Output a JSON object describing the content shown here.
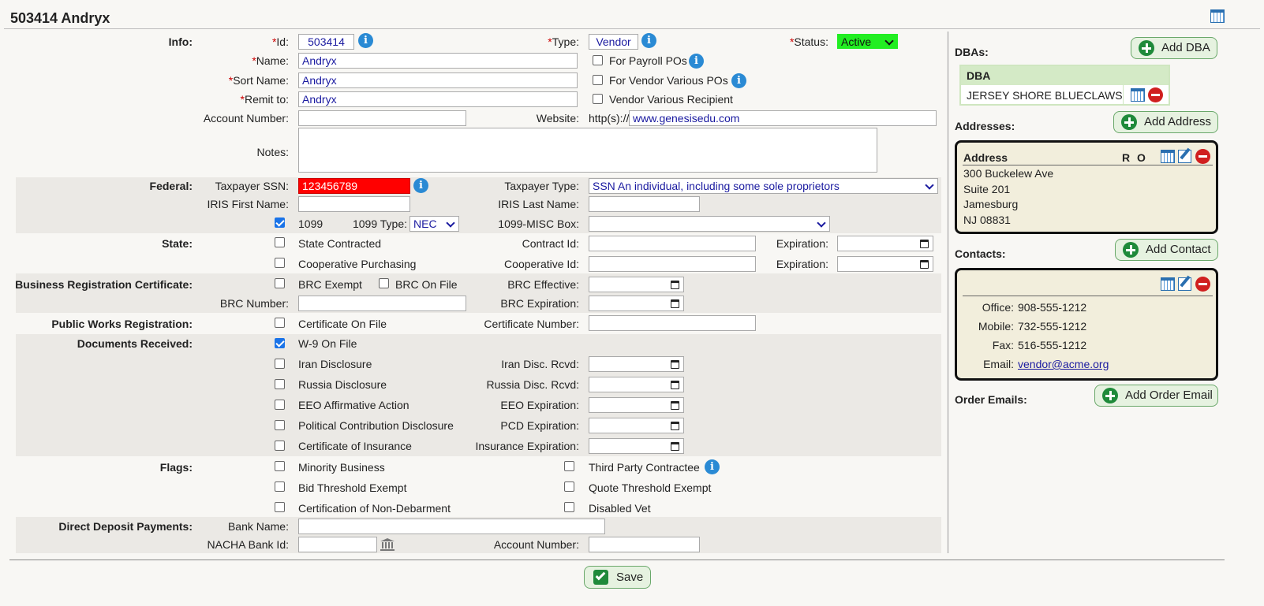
{
  "header": {
    "title": "503414 Andryx"
  },
  "info": {
    "section": "Info:",
    "id_label": "Id:",
    "id_value": "503414",
    "type_label": "Type:",
    "type_value": "Vendor",
    "status_label": "Status:",
    "status_value": "Active",
    "name_label": "Name:",
    "name_value": "Andryx",
    "sortname_label": "Sort Name:",
    "sortname_value": "Andryx",
    "remit_label": "Remit to:",
    "remit_value": "Andryx",
    "account_label": "Account Number:",
    "account_value": "",
    "website_label": "Website:",
    "website_prefix": "http(s)://",
    "website_value": "www.genesisedu.com",
    "notes_label": "Notes:",
    "notes_value": "",
    "for_payroll": "For Payroll POs",
    "for_vendor_various": "For Vendor Various POs",
    "vendor_various_recipient": "Vendor Various Recipient",
    "star": "*"
  },
  "federal": {
    "section": "Federal:",
    "ssn_label": "Taxpayer SSN:",
    "ssn_value": "123456789",
    "taxpayer_type_label": "Taxpayer Type:",
    "taxpayer_type_value": "SSN An individual, including some sole proprietors",
    "iris_first_label": "IRIS First Name:",
    "iris_first_value": "",
    "iris_last_label": "IRIS Last Name:",
    "iris_last_value": "",
    "f1099_label": "1099",
    "f1099_checked": true,
    "type1099_label": "1099 Type:",
    "type1099_value": "NEC",
    "misc_label": "1099-MISC Box:",
    "misc_value": ""
  },
  "state": {
    "section": "State:",
    "contracted": "State Contracted",
    "contract_id_label": "Contract Id:",
    "expiration_label": "Expiration:",
    "coop": "Cooperative Purchasing",
    "coop_id_label": "Cooperative Id:"
  },
  "brc": {
    "section": "Business Registration Certificate:",
    "exempt": "BRC Exempt",
    "on_file": "BRC On File",
    "effective_label": "BRC Effective:",
    "number_label": "BRC Number:",
    "expiration_label": "BRC Expiration:"
  },
  "pwr": {
    "section": "Public Works Registration:",
    "cert_on_file": "Certificate On File",
    "cert_number_label": "Certificate Number:"
  },
  "docs": {
    "section": "Documents Received:",
    "w9": "W-9 On File",
    "iran": "Iran Disclosure",
    "iran_rcvd": "Iran Disc. Rcvd:",
    "russia": "Russia Disclosure",
    "russia_rcvd": "Russia Disc. Rcvd:",
    "eeo": "EEO Affirmative Action",
    "eeo_exp": "EEO Expiration:",
    "pcd": "Political Contribution Disclosure",
    "pcd_exp": "PCD Expiration:",
    "coi": "Certificate of Insurance",
    "ins_exp": "Insurance Expiration:"
  },
  "flags": {
    "section": "Flags:",
    "minority": "Minority Business",
    "third_party": "Third Party Contractee",
    "bid": "Bid Threshold Exempt",
    "quote": "Quote Threshold Exempt",
    "nondebar": "Certification of Non-Debarment",
    "vet": "Disabled Vet"
  },
  "dd": {
    "section": "Direct Deposit Payments:",
    "bank_label": "Bank Name:",
    "nacha_label": "NACHA Bank Id:",
    "acct_label": "Account Number:"
  },
  "save_label": "Save",
  "side": {
    "dbas_label": "DBAs:",
    "add_dba": "Add DBA",
    "dba_header": "DBA",
    "dba_value": "JERSEY SHORE BLUECLAWS",
    "addresses_label": "Addresses:",
    "add_address": "Add Address",
    "address_header": "Address",
    "r": "R",
    "o": "O",
    "addr1": "300 Buckelew Ave",
    "addr2": "Suite 201",
    "addr3": "Jamesburg",
    "addr4": "NJ 08831",
    "contacts_label": "Contacts:",
    "add_contact": "Add Contact",
    "office_label": "Office:",
    "office": "908-555-1212",
    "mobile_label": "Mobile:",
    "mobile": "732-555-1212",
    "fax_label": "Fax:",
    "fax": "516-555-1212",
    "email_label": "Email:",
    "email": "vendor@acme.org",
    "order_label": "Order Emails:",
    "add_order": "Add Order Email"
  },
  "colors": {
    "status": "#22ee22",
    "ssn": "#ff0000",
    "band": "#ebe9e5",
    "card": "#f2eedc"
  }
}
